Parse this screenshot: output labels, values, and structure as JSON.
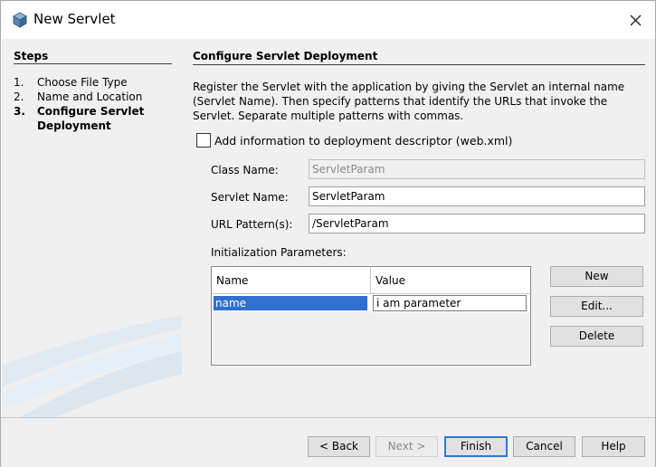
{
  "window": {
    "title": "New Servlet"
  },
  "steps": {
    "heading": "Steps",
    "items": [
      {
        "num": "1.",
        "label": "Choose File Type",
        "current": false
      },
      {
        "num": "2.",
        "label": "Name and Location",
        "current": false
      },
      {
        "num": "3.",
        "label": "Configure Servlet Deployment",
        "current": true
      }
    ]
  },
  "content": {
    "title": "Configure Servlet Deployment",
    "description": "Register the Servlet with the application by giving the Servlet an internal name (Servlet Name). Then specify patterns that identify the URLs that invoke the Servlet. Separate multiple patterns with commas.",
    "checkbox_label": "Add information to deployment descriptor (web.xml)",
    "checkbox_checked": false,
    "class_name_label": "Class Name:",
    "class_name_value": "ServletParam",
    "servlet_name_label": "Servlet Name:",
    "servlet_name_value": "ServletParam",
    "url_pattern_label": "URL Pattern(s):",
    "url_pattern_value": "/ServletParam",
    "init_params_label": "Initialization Parameters:",
    "table": {
      "columns": [
        "Name",
        "Value"
      ],
      "rows": [
        {
          "name": "name",
          "value": "i am parameter"
        }
      ]
    },
    "buttons": {
      "new": "New",
      "edit": "Edit...",
      "delete": "Delete"
    }
  },
  "footer": {
    "back": "< Back",
    "next": "Next >",
    "finish": "Finish",
    "cancel": "Cancel",
    "help": "Help"
  },
  "colors": {
    "selection": "#2f6fcf",
    "panel": "#f0f0f0"
  }
}
